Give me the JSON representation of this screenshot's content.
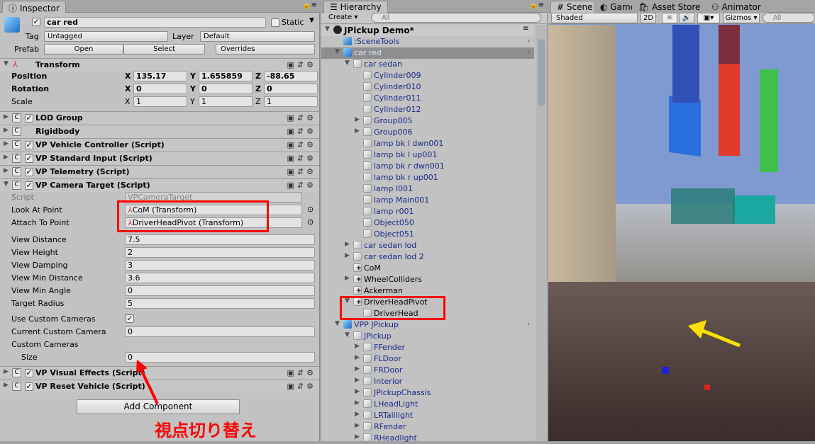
{
  "inspector": {
    "tab": "Inspector",
    "object_name": "car red",
    "active": true,
    "static_label": "Static",
    "static": false,
    "tag_label": "Tag",
    "tag": "Untagged",
    "layer_label": "Layer",
    "layer": "Default",
    "prefab_label": "Prefab",
    "open": "Open",
    "select": "Select",
    "overrides": "Overrides",
    "transform": {
      "title": "Transform",
      "position_label": "Position",
      "rotation_label": "Rotation",
      "scale_label": "Scale",
      "position": {
        "x": "135.17",
        "y": "1.655859",
        "z": "-88.65"
      },
      "rotation": {
        "x": "0",
        "y": "0",
        "z": "0"
      },
      "scale": {
        "x": "1",
        "y": "1",
        "z": "1"
      }
    },
    "axes": {
      "x": "X",
      "y": "Y",
      "z": "Z"
    },
    "components": [
      "LOD Group",
      "Rigidbody",
      "VP Vehicle Controller (Script)",
      "VP Standard Input (Script)",
      "VP Telemetry (Script)"
    ],
    "camera_target": {
      "title": "VP Camera Target (Script)",
      "script_label": "Script",
      "script": "VPCameraTarget",
      "look_at_label": "Look At Point",
      "look_at": "CoM (Transform)",
      "attach_label": "Attach To Point",
      "attach": "DriverHeadPivot (Transform)",
      "props": [
        {
          "label": "View Distance",
          "value": "7.5"
        },
        {
          "label": "View Height",
          "value": "2"
        },
        {
          "label": "View Damping",
          "value": "3"
        },
        {
          "label": "View Min Distance",
          "value": "3.6"
        },
        {
          "label": "View Min Angle",
          "value": "0"
        },
        {
          "label": "Target Radius",
          "value": "5"
        }
      ],
      "use_custom_label": "Use Custom Cameras",
      "use_custom": true,
      "current_custom_label": "Current Custom Camera",
      "current_custom": "0",
      "custom_cameras_label": "Custom Cameras",
      "size_label": "Size",
      "size": "0"
    },
    "components_after": [
      "VP Visual Effects (Script)",
      "VP Reset Vehicle (Script)"
    ],
    "add_component": "Add Component"
  },
  "annotation": {
    "text": "視点切り替え",
    "color": "#ff0000",
    "arrow2_color": "#ffe000"
  },
  "hierarchy": {
    "tab": "Hierarchy",
    "create": "Create",
    "search_placeholder": "All",
    "items": [
      {
        "label": "JPickup Demo*",
        "level": 0,
        "arrow": "down",
        "kind": "scene"
      },
      {
        "label": ":SceneTools",
        "level": 1,
        "arrow": "",
        "kind": "prefab-root",
        "chevron": true
      },
      {
        "label": "car red",
        "level": 1,
        "arrow": "down",
        "kind": "prefab-root",
        "chevron": true,
        "selected": true
      },
      {
        "label": "car sedan",
        "level": 2,
        "arrow": "down",
        "kind": "prefab"
      },
      {
        "label": "Cylinder009",
        "level": 3,
        "arrow": "",
        "kind": "prefab"
      },
      {
        "label": "Cylinder010",
        "level": 3,
        "arrow": "",
        "kind": "prefab"
      },
      {
        "label": "Cylinder011",
        "level": 3,
        "arrow": "",
        "kind": "prefab"
      },
      {
        "label": "Cylinder012",
        "level": 3,
        "arrow": "",
        "kind": "prefab"
      },
      {
        "label": "Group005",
        "level": 3,
        "arrow": "right",
        "kind": "prefab"
      },
      {
        "label": "Group006",
        "level": 3,
        "arrow": "right",
        "kind": "prefab"
      },
      {
        "label": "lamp bk l dwn001",
        "level": 3,
        "arrow": "",
        "kind": "prefab"
      },
      {
        "label": "lamp bk l up001",
        "level": 3,
        "arrow": "",
        "kind": "prefab"
      },
      {
        "label": "lamp bk r dwn001",
        "level": 3,
        "arrow": "",
        "kind": "prefab"
      },
      {
        "label": "lamp bk r up001",
        "level": 3,
        "arrow": "",
        "kind": "prefab"
      },
      {
        "label": "lamp l001",
        "level": 3,
        "arrow": "",
        "kind": "prefab"
      },
      {
        "label": "lamp Main001",
        "level": 3,
        "arrow": "",
        "kind": "prefab"
      },
      {
        "label": "lamp r001",
        "level": 3,
        "arrow": "",
        "kind": "prefab"
      },
      {
        "label": "Object050",
        "level": 3,
        "arrow": "",
        "kind": "prefab"
      },
      {
        "label": "Object051",
        "level": 3,
        "arrow": "",
        "kind": "prefab"
      },
      {
        "label": "car sedan lod",
        "level": 2,
        "arrow": "right",
        "kind": "prefab"
      },
      {
        "label": "car sedan lod 2",
        "level": 2,
        "arrow": "right",
        "kind": "prefab"
      },
      {
        "label": "CoM",
        "level": 2,
        "arrow": "",
        "kind": "added"
      },
      {
        "label": "WheelColliders",
        "level": 2,
        "arrow": "right",
        "kind": "added"
      },
      {
        "label": "Ackerman",
        "level": 2,
        "arrow": "",
        "kind": "added"
      },
      {
        "label": "DriverHeadPivot",
        "level": 2,
        "arrow": "down",
        "kind": "added"
      },
      {
        "label": "DriverHead",
        "level": 3,
        "arrow": "",
        "kind": "plain"
      },
      {
        "label": "VPP JPickup",
        "level": 1,
        "arrow": "down",
        "kind": "prefab-root",
        "chevron": true
      },
      {
        "label": "JPickup",
        "level": 2,
        "arrow": "down",
        "kind": "prefab"
      },
      {
        "label": "FFender",
        "level": 3,
        "arrow": "right",
        "kind": "prefab"
      },
      {
        "label": "FLDoor",
        "level": 3,
        "arrow": "right",
        "kind": "prefab"
      },
      {
        "label": "FRDoor",
        "level": 3,
        "arrow": "right",
        "kind": "prefab"
      },
      {
        "label": "Interior",
        "level": 3,
        "arrow": "right",
        "kind": "prefab"
      },
      {
        "label": "JPickupChassis",
        "level": 3,
        "arrow": "right",
        "kind": "prefab"
      },
      {
        "label": "LHeadLight",
        "level": 3,
        "arrow": "right",
        "kind": "prefab"
      },
      {
        "label": "LRTaillight",
        "level": 3,
        "arrow": "right",
        "kind": "prefab"
      },
      {
        "label": "RFender",
        "level": 3,
        "arrow": "right",
        "kind": "prefab"
      },
      {
        "label": "RHeadlight",
        "level": 3,
        "arrow": "right",
        "kind": "prefab"
      }
    ]
  },
  "scene": {
    "tabs": [
      "Scene",
      "Game",
      "Asset Store",
      "Animator"
    ],
    "active_tab": "Scene",
    "shading": "Shaded",
    "mode_2d": "2D",
    "gizmos": "Gizmos",
    "search_placeholder": "All"
  }
}
